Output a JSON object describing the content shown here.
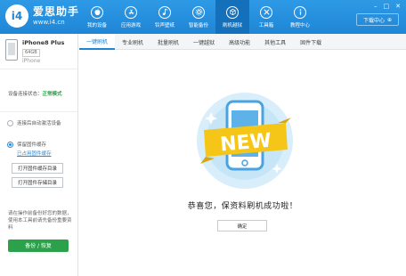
{
  "app": {
    "logo_badge": "i4",
    "logo_name": "爱思助手",
    "logo_url": "www.i4.cn"
  },
  "nav": [
    {
      "label": "我的设备",
      "icon": "apple-icon"
    },
    {
      "label": "应用游戏",
      "icon": "app-store-icon"
    },
    {
      "label": "铃声壁纸",
      "icon": "music-icon"
    },
    {
      "label": "智能备份",
      "icon": "settings-icon"
    },
    {
      "label": "刷机越狱",
      "icon": "box-icon",
      "active": true
    },
    {
      "label": "工具箱",
      "icon": "tools-icon"
    },
    {
      "label": "教程中心",
      "icon": "info-icon"
    }
  ],
  "download_label": "下载中心",
  "device": {
    "name": "iPhone8 Plus",
    "capacity": "64GB",
    "type": "iPhone"
  },
  "connection": {
    "label": "设备连接状态：",
    "status": "正常模式"
  },
  "sidebar": {
    "opt_auto_activate": "连接后自动激活设备",
    "opt_keep_firmware": "保留固件缓存",
    "firmware_link": "已占用固件缓存",
    "btn_open_firmware_dir": "打开固件缓存目录",
    "btn_open_backup_dir": "打开固件存储目录",
    "tip": "请在操作前备份好您的数据，使用本工具前请先备份重要资料",
    "backup_button": "备份 / 恢复"
  },
  "tabs": [
    "一键刷机",
    "专业刷机",
    "批量刷机",
    "一键越狱",
    "高级功能",
    "其他工具",
    "固件下载"
  ],
  "main": {
    "badge_text": "NEW",
    "success_message": "恭喜您，保资料刷机成功啦！",
    "ok_button": "确定"
  },
  "colors": {
    "brand": "#1f86d6",
    "success": "#2aa14a",
    "badge_yellow": "#f5c518"
  }
}
